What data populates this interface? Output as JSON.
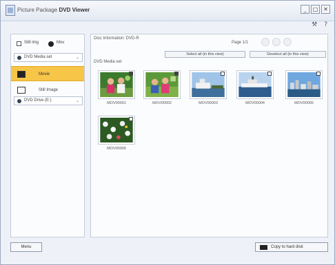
{
  "window": {
    "title_prefix": "Picture Package",
    "title_bold": "DVD Viewer",
    "minimize": "_",
    "maximize": "□",
    "close": "✕"
  },
  "toolbar": {
    "icons": [
      "tools-icon",
      "help-icon"
    ]
  },
  "sidebar": {
    "view_option_1": "Still img",
    "view_option_2": "Mov",
    "media_dropdown": "DVD Media set",
    "items": [
      {
        "label": "Movie",
        "selected": true,
        "icon": "film-icon"
      },
      {
        "label": "Still Image",
        "selected": false,
        "icon": "image-icon"
      }
    ],
    "drive_dropdown": "DVD Drive (E:)"
  },
  "main": {
    "path": "Disc Information: DVD-R",
    "page": "Page 1/1",
    "btn_select_all": "Select all (in this view)",
    "btn_deselect_all": "Deselect all (in this view)",
    "section": "DVD Media set",
    "thumbnails": [
      {
        "caption": "MOV00001",
        "checked": true,
        "scene": "people1"
      },
      {
        "caption": "MOV00002",
        "checked": true,
        "scene": "people2"
      },
      {
        "caption": "MOV00003",
        "checked": false,
        "scene": "boat"
      },
      {
        "caption": "MOV00004",
        "checked": false,
        "scene": "ship"
      },
      {
        "caption": "MOV00005",
        "checked": false,
        "scene": "city"
      },
      {
        "caption": "MOV00006",
        "checked": false,
        "scene": "flowers"
      }
    ]
  },
  "footer": {
    "left_button": "Menu",
    "right_button": "Copy to hard disk"
  }
}
